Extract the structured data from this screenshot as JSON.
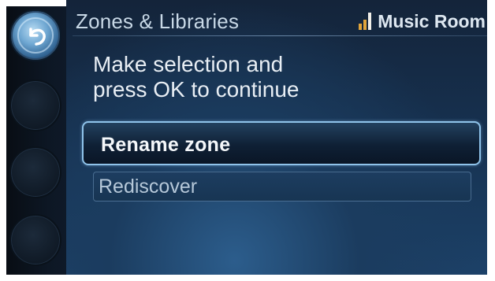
{
  "header": {
    "title": "Zones & Libraries",
    "room_name": "Music Room",
    "signal_icon": "signal-strength-icon"
  },
  "instruction": "Make selection and\npress OK to continue",
  "options": [
    {
      "label": "Rename zone",
      "selected": true
    },
    {
      "label": "Rediscover",
      "selected": false
    }
  ],
  "side_buttons": {
    "back_icon": "back-arrow-icon"
  },
  "colors": {
    "accent": "#8fc3ea",
    "signal": "#e0a43a",
    "background": "#16304e"
  }
}
